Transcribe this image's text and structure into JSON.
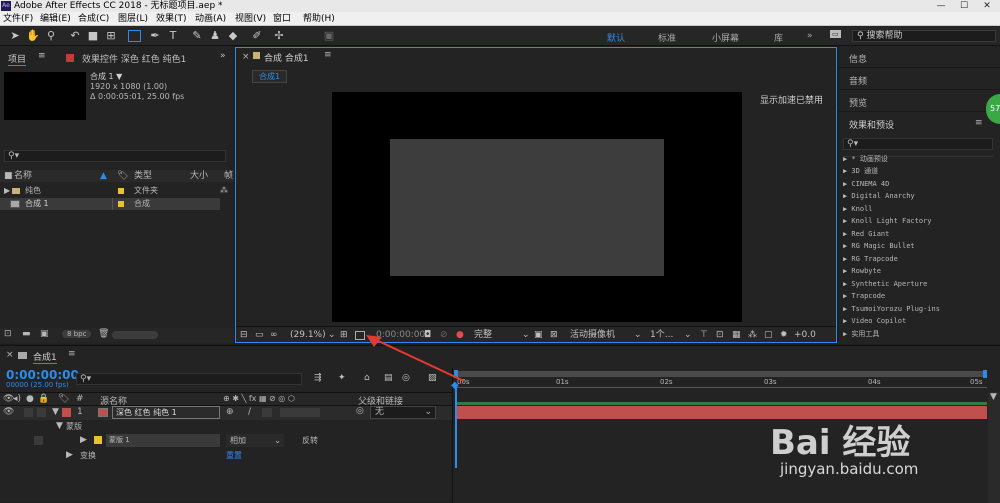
{
  "titlebar": {
    "title": "Adobe After Effects CC 2018 - 无标题项目.aep *",
    "app_logo": "Ae"
  },
  "menu": [
    "文件(F)",
    "编辑(E)",
    "合成(C)",
    "图层(L)",
    "效果(T)",
    "动画(A)",
    "视图(V)",
    "窗口",
    "帮助(H)"
  ],
  "workspaces": [
    "默认",
    "标准",
    "小屏幕",
    "库"
  ],
  "search_help": "搜索帮助",
  "project": {
    "tab": "项目",
    "effects_tab": "效果控件 深色 红色 纯色1",
    "item_name": "合成 1 ▼",
    "item_res": "1920 x 1080 (1.00)",
    "item_dur": "Δ 0:00:05:01, 25.00 fps",
    "headers": [
      "名称",
      "类型",
      "大小",
      "帧"
    ],
    "rows": [
      {
        "name": "纯色",
        "type": "文件夹"
      },
      {
        "name": "合成 1",
        "type": "合成"
      }
    ],
    "bpc": "8 bpc"
  },
  "composition": {
    "tab": "合成 合成1",
    "subtab": "合成1",
    "gpu_text": "显示加速已禁用",
    "zoom": "(29.1%)",
    "timecode": "0:00:00:00",
    "quality": "完整",
    "camera": "活动摄像机",
    "views": "1个...",
    "exposure": "+0.0"
  },
  "right_panels": {
    "items": [
      "信息",
      "音频",
      "预览",
      "效果和预设"
    ],
    "effects": [
      "▶ * 动画预设",
      "▶ 3D 通道",
      "▶ CINEMA 4D",
      "▶ Digital Anarchy",
      "▶ Knoll",
      "▶ Knoll Light Factory",
      "▶ Red Giant",
      "▶ RG Magic Bullet",
      "▶ RG Trapcode",
      "▶ Rowbyte",
      "▶ Synthetic Aperture",
      "▶ Trapcode",
      "▶ TsumoiYorozu Plug-ins",
      "▶ Video Copilot",
      "▶ 实用工具"
    ]
  },
  "timeline": {
    "tab": "合成1",
    "timecode": "0:00:00:00",
    "fps": "00000 (25.00 fps)",
    "col_source": "源名称",
    "col_parent": "父级和链接",
    "layer_num": "1",
    "layer_name": "深色 红色 纯色 1",
    "parent_value": "无",
    "masks": "蒙版",
    "mask_name": "蒙版 1",
    "blend": "相加",
    "invert": "反转",
    "transform": "变换",
    "reset": "重置",
    "ticks": [
      "00s",
      "01s",
      "02s",
      "03s",
      "04s",
      "05s"
    ]
  },
  "watermark": {
    "brand": "Bai 经验",
    "url": "jingyan.baidu.com"
  },
  "side_badge": "57",
  "colors": {
    "accent": "#2d8ceb",
    "layer_red": "#c0504d",
    "arrow": "#e23a2e"
  }
}
